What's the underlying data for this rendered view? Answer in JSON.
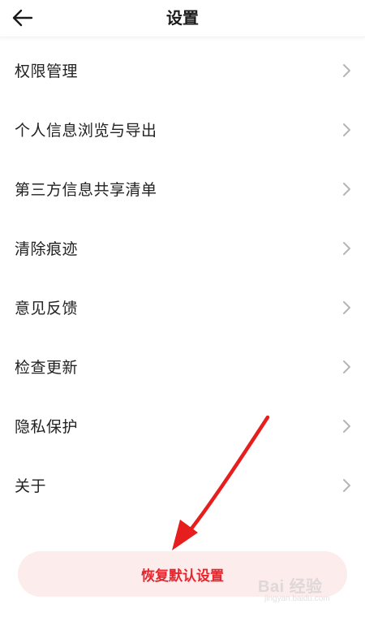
{
  "header": {
    "title": "设置",
    "back_icon": "arrow-left-icon"
  },
  "settings": {
    "items": [
      {
        "label": "权限管理"
      },
      {
        "label": "个人信息浏览与导出"
      },
      {
        "label": "第三方信息共享清单"
      },
      {
        "label": "清除痕迹"
      },
      {
        "label": "意见反馈"
      },
      {
        "label": "检查更新"
      },
      {
        "label": "隐私保护"
      },
      {
        "label": "关于"
      }
    ],
    "chevron_icon": "chevron-right-icon"
  },
  "restore": {
    "label": "恢复默认设置"
  },
  "watermark": {
    "brand": "Bai 经验",
    "url": "jingyan.baidu.com"
  },
  "colors": {
    "accent": "#e8242c",
    "restore_bg": "#fdecec",
    "text": "#222222",
    "chevron": "#b5b5b5",
    "arrow": "#e61e1e"
  }
}
